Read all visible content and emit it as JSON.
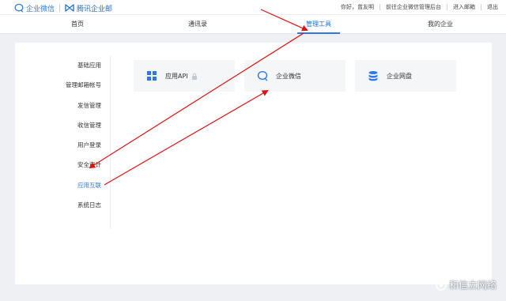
{
  "brand": {
    "product1": "企业微信",
    "product2": "腾讯企业邮"
  },
  "top_links": {
    "greeting": "你好，曾友明",
    "goto_admin": "前往企业微信管理后台",
    "inbox": "进入邮箱",
    "logout": "退出"
  },
  "nav": {
    "tabs": [
      "首页",
      "通讯录",
      "管理工具",
      "我的企业"
    ],
    "active": "管理工具"
  },
  "sidebar": {
    "items": [
      "基础应用",
      "管理邮箱帐号",
      "发信管理",
      "收信管理",
      "用户登录",
      "安全审计",
      "应用互联",
      "系统日志"
    ],
    "active": "应用互联"
  },
  "cards": [
    {
      "label": "应用API",
      "icon": "grid-icon",
      "locked": true
    },
    {
      "label": "企业微信",
      "icon": "wecom-icon"
    },
    {
      "label": "企业网盘",
      "icon": "database-icon"
    }
  ],
  "watermark": "和信立网络",
  "colors": {
    "accent": "#2d78e4",
    "annotation": "#e01010",
    "card_bg": "#f5f6f8",
    "page_bg": "#eef0f3"
  }
}
